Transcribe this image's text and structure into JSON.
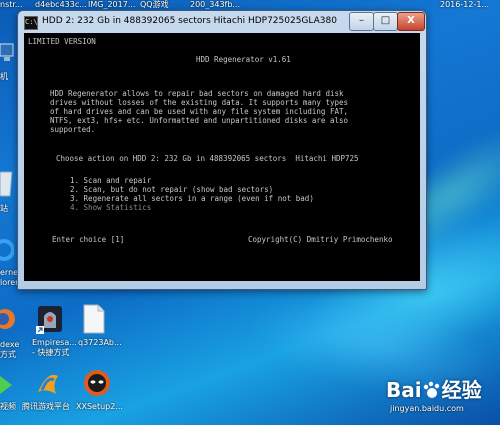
{
  "taskbar_top_labels": [
    "nstr...",
    "d4ebc433c...",
    "IMG_2017...",
    "QQ游戏",
    "200_343fb...",
    "2016-12-1..."
  ],
  "desktop_icons": [
    {
      "label": "机",
      "icon": "computer-icon"
    },
    {
      "label": "站",
      "icon": "recycle-bin-icon"
    },
    {
      "label": "ernet",
      "icon": "ie-icon"
    },
    {
      "label": "lorer",
      "icon": "ie-icon"
    },
    {
      "label": "dexe",
      "icon": "firefox-icon"
    },
    {
      "label": "方式",
      "icon": "shortcut-arrow-icon"
    },
    {
      "label": "Empiresa...",
      "icon": "empire-app-icon"
    },
    {
      "label": "- 快捷方式",
      "icon": "shortcut-arrow-icon"
    },
    {
      "label": "q3723Ab...",
      "icon": "file-icon"
    },
    {
      "label": "视频",
      "icon": "video-icon"
    },
    {
      "label": "腾讯游戏平台",
      "icon": "qq-game-icon"
    },
    {
      "label": "XXSetup2...",
      "icon": "setup-app-icon"
    }
  ],
  "window": {
    "title": "HDD 2: 232 Gb in 488392065 sectors  Hitachi HDP725025GLA380",
    "buttons": {
      "minimize": "–",
      "maximize": "□",
      "close": "X"
    }
  },
  "console": {
    "limited_version": "LIMITED VERSION",
    "app_title": "HDD Regenerator v1.61",
    "description": [
      "HDD Regenerator allows to repair bad sectors on damaged hard disk",
      "drives without losses of the existing data. It supports many types",
      "of hard drives and can be used with any file system including FAT,",
      "NTFS, ext3, hfs+ etc. Unformatted and unpartitioned disks are also",
      "supported."
    ],
    "choose_action": "Choose action on HDD 2: 232 Gb in 488392065 sectors  Hitachi HDP725",
    "options": [
      "1. Scan and repair",
      "2. Scan, but do not repair (show bad sectors)",
      "3. Regenerate all sectors in a range (even if not bad)",
      "4. Show Statistics"
    ],
    "prompt": "Enter choice [1]",
    "copyright": "Copyright(C) Dmitriy Primochenko"
  },
  "watermark": {
    "brand": "Bai",
    "brand_tail": "经验",
    "url": "jingyan.baidu.com"
  }
}
